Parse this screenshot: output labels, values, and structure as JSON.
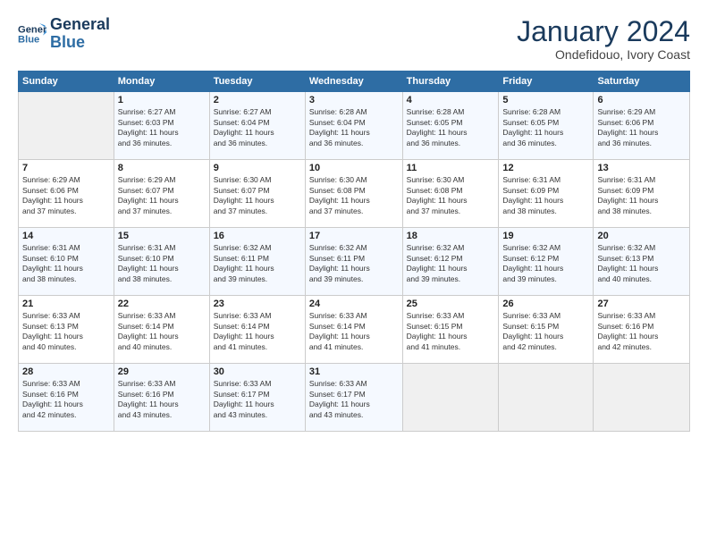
{
  "logo": {
    "line1": "General",
    "line2": "Blue"
  },
  "title": "January 2024",
  "subtitle": "Ondefidouo, Ivory Coast",
  "days_header": [
    "Sunday",
    "Monday",
    "Tuesday",
    "Wednesday",
    "Thursday",
    "Friday",
    "Saturday"
  ],
  "weeks": [
    [
      {
        "day": "",
        "info": ""
      },
      {
        "day": "1",
        "info": "Sunrise: 6:27 AM\nSunset: 6:03 PM\nDaylight: 11 hours\nand 36 minutes."
      },
      {
        "day": "2",
        "info": "Sunrise: 6:27 AM\nSunset: 6:04 PM\nDaylight: 11 hours\nand 36 minutes."
      },
      {
        "day": "3",
        "info": "Sunrise: 6:28 AM\nSunset: 6:04 PM\nDaylight: 11 hours\nand 36 minutes."
      },
      {
        "day": "4",
        "info": "Sunrise: 6:28 AM\nSunset: 6:05 PM\nDaylight: 11 hours\nand 36 minutes."
      },
      {
        "day": "5",
        "info": "Sunrise: 6:28 AM\nSunset: 6:05 PM\nDaylight: 11 hours\nand 36 minutes."
      },
      {
        "day": "6",
        "info": "Sunrise: 6:29 AM\nSunset: 6:06 PM\nDaylight: 11 hours\nand 36 minutes."
      }
    ],
    [
      {
        "day": "7",
        "info": "Sunrise: 6:29 AM\nSunset: 6:06 PM\nDaylight: 11 hours\nand 37 minutes."
      },
      {
        "day": "8",
        "info": "Sunrise: 6:29 AM\nSunset: 6:07 PM\nDaylight: 11 hours\nand 37 minutes."
      },
      {
        "day": "9",
        "info": "Sunrise: 6:30 AM\nSunset: 6:07 PM\nDaylight: 11 hours\nand 37 minutes."
      },
      {
        "day": "10",
        "info": "Sunrise: 6:30 AM\nSunset: 6:08 PM\nDaylight: 11 hours\nand 37 minutes."
      },
      {
        "day": "11",
        "info": "Sunrise: 6:30 AM\nSunset: 6:08 PM\nDaylight: 11 hours\nand 37 minutes."
      },
      {
        "day": "12",
        "info": "Sunrise: 6:31 AM\nSunset: 6:09 PM\nDaylight: 11 hours\nand 38 minutes."
      },
      {
        "day": "13",
        "info": "Sunrise: 6:31 AM\nSunset: 6:09 PM\nDaylight: 11 hours\nand 38 minutes."
      }
    ],
    [
      {
        "day": "14",
        "info": "Sunrise: 6:31 AM\nSunset: 6:10 PM\nDaylight: 11 hours\nand 38 minutes."
      },
      {
        "day": "15",
        "info": "Sunrise: 6:31 AM\nSunset: 6:10 PM\nDaylight: 11 hours\nand 38 minutes."
      },
      {
        "day": "16",
        "info": "Sunrise: 6:32 AM\nSunset: 6:11 PM\nDaylight: 11 hours\nand 39 minutes."
      },
      {
        "day": "17",
        "info": "Sunrise: 6:32 AM\nSunset: 6:11 PM\nDaylight: 11 hours\nand 39 minutes."
      },
      {
        "day": "18",
        "info": "Sunrise: 6:32 AM\nSunset: 6:12 PM\nDaylight: 11 hours\nand 39 minutes."
      },
      {
        "day": "19",
        "info": "Sunrise: 6:32 AM\nSunset: 6:12 PM\nDaylight: 11 hours\nand 39 minutes."
      },
      {
        "day": "20",
        "info": "Sunrise: 6:32 AM\nSunset: 6:13 PM\nDaylight: 11 hours\nand 40 minutes."
      }
    ],
    [
      {
        "day": "21",
        "info": "Sunrise: 6:33 AM\nSunset: 6:13 PM\nDaylight: 11 hours\nand 40 minutes."
      },
      {
        "day": "22",
        "info": "Sunrise: 6:33 AM\nSunset: 6:14 PM\nDaylight: 11 hours\nand 40 minutes."
      },
      {
        "day": "23",
        "info": "Sunrise: 6:33 AM\nSunset: 6:14 PM\nDaylight: 11 hours\nand 41 minutes."
      },
      {
        "day": "24",
        "info": "Sunrise: 6:33 AM\nSunset: 6:14 PM\nDaylight: 11 hours\nand 41 minutes."
      },
      {
        "day": "25",
        "info": "Sunrise: 6:33 AM\nSunset: 6:15 PM\nDaylight: 11 hours\nand 41 minutes."
      },
      {
        "day": "26",
        "info": "Sunrise: 6:33 AM\nSunset: 6:15 PM\nDaylight: 11 hours\nand 42 minutes."
      },
      {
        "day": "27",
        "info": "Sunrise: 6:33 AM\nSunset: 6:16 PM\nDaylight: 11 hours\nand 42 minutes."
      }
    ],
    [
      {
        "day": "28",
        "info": "Sunrise: 6:33 AM\nSunset: 6:16 PM\nDaylight: 11 hours\nand 42 minutes."
      },
      {
        "day": "29",
        "info": "Sunrise: 6:33 AM\nSunset: 6:16 PM\nDaylight: 11 hours\nand 43 minutes."
      },
      {
        "day": "30",
        "info": "Sunrise: 6:33 AM\nSunset: 6:17 PM\nDaylight: 11 hours\nand 43 minutes."
      },
      {
        "day": "31",
        "info": "Sunrise: 6:33 AM\nSunset: 6:17 PM\nDaylight: 11 hours\nand 43 minutes."
      },
      {
        "day": "",
        "info": ""
      },
      {
        "day": "",
        "info": ""
      },
      {
        "day": "",
        "info": ""
      }
    ]
  ]
}
